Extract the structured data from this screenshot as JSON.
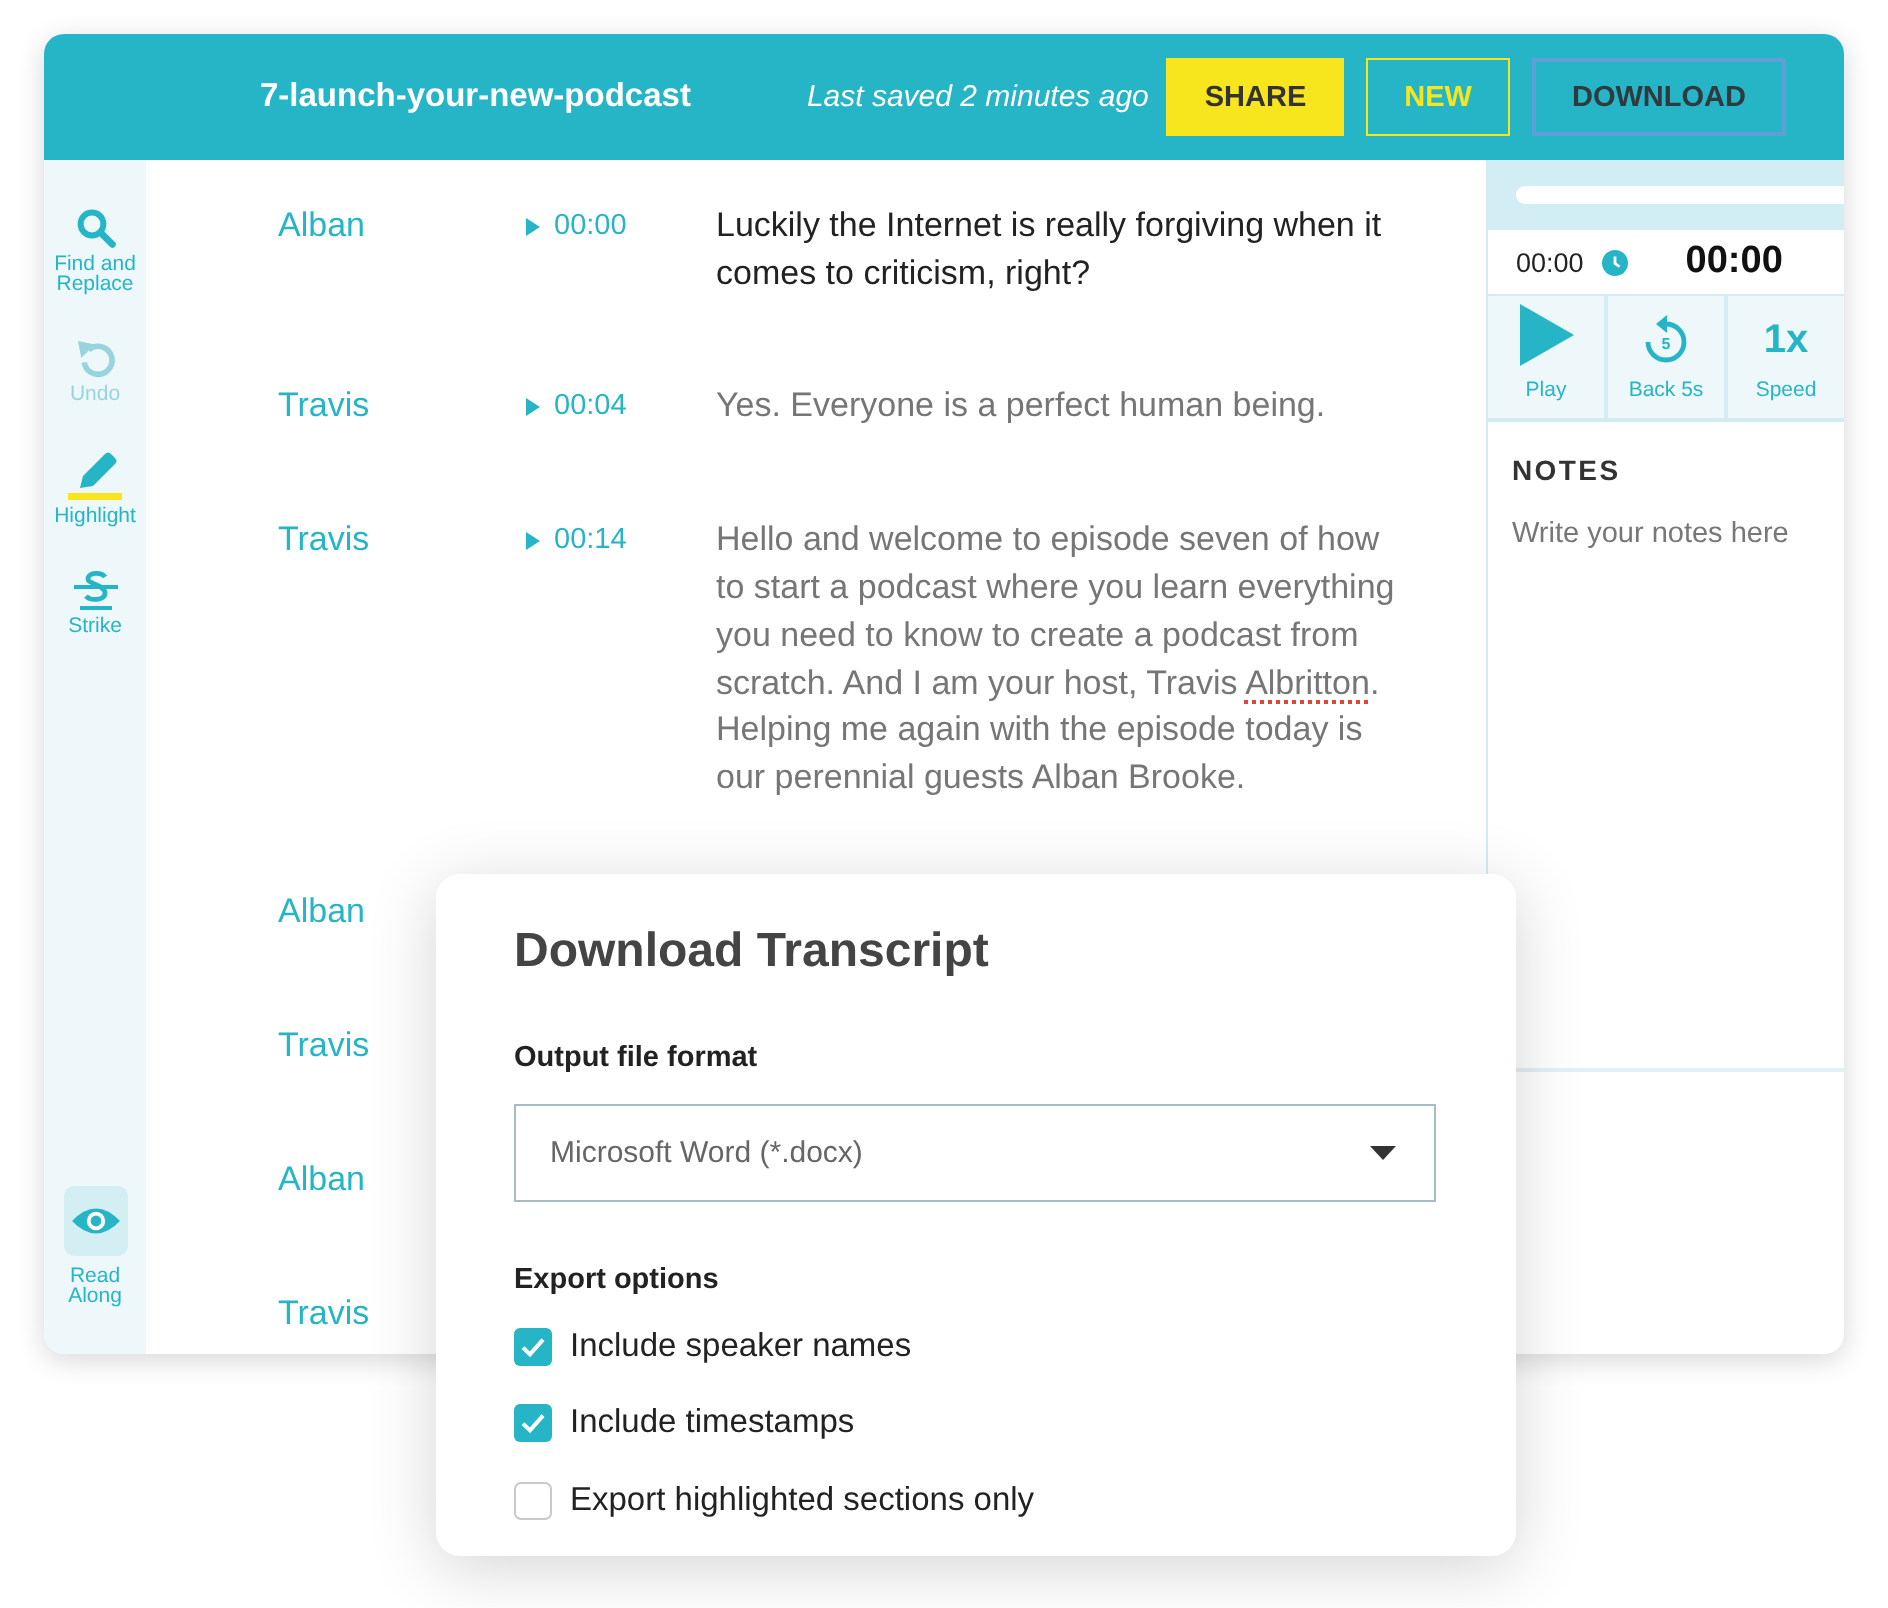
{
  "header": {
    "title": "7-launch-your-new-podcast",
    "status": "Last saved 2 minutes ago",
    "buttons": [
      {
        "label": "SHARE",
        "kind": "solid"
      },
      {
        "label": "NEW",
        "kind": "outline"
      },
      {
        "label": "DOWNLOAD",
        "kind": "focused"
      }
    ]
  },
  "sidebar": {
    "tools": [
      {
        "kind": "find",
        "label": "Find and Replace",
        "disabled": false
      },
      {
        "kind": "undo",
        "label": "Undo",
        "disabled": true
      },
      {
        "kind": "highlight",
        "label": "Highlight",
        "disabled": false
      },
      {
        "kind": "strike",
        "label": "Strike",
        "disabled": false
      }
    ],
    "read_along": {
      "label": "Read Along",
      "on": true
    }
  },
  "transcript": {
    "rows": [
      {
        "speaker": "Alban",
        "time": "00:00",
        "current": true,
        "text": [
          {
            "text": "Luckily the Internet is really forgiving when it comes to criticism, right?",
            "misspelled": false
          }
        ]
      },
      {
        "speaker": "Travis",
        "time": "00:04",
        "current": false,
        "text": [
          {
            "text": "Yes. Everyone is a perfect human being.",
            "misspelled": false
          }
        ]
      },
      {
        "speaker": "Travis",
        "time": "00:14",
        "current": false,
        "text": [
          {
            "text": "Hello and welcome to episode seven of how to start a podcast where you learn everything you need to know to create a podcast from scratch. And I am your host, Travis ",
            "misspelled": false
          },
          {
            "text": "Albritton",
            "misspelled": true
          },
          {
            "text": ". Helping me again with the episode today is our perennial guests Alban Brooke.",
            "misspelled": false
          }
        ]
      },
      {
        "speaker": "Alban"
      },
      {
        "speaker": "Travis"
      },
      {
        "speaker": "Alban"
      },
      {
        "speaker": "Travis"
      }
    ]
  },
  "player": {
    "elapsed": "00:00",
    "current_time": "00:00",
    "controls": [
      {
        "kind": "play",
        "label": "Play"
      },
      {
        "kind": "back",
        "label": "Back 5s",
        "icon_text": "5"
      },
      {
        "kind": "speed",
        "label": "Speed",
        "value": "1x"
      }
    ]
  },
  "notes": {
    "heading": "NOTES",
    "placeholder": "Write your notes here"
  },
  "dialog": {
    "title": "Download Transcript",
    "format_label": "Output file format",
    "format_value": "Microsoft Word (*.docx)",
    "options_label": "Export options",
    "options": [
      {
        "label": "Include speaker names",
        "checked": true
      },
      {
        "label": "Include timestamps",
        "checked": true
      },
      {
        "label": "Export highlighted sections only",
        "checked": false
      }
    ]
  }
}
